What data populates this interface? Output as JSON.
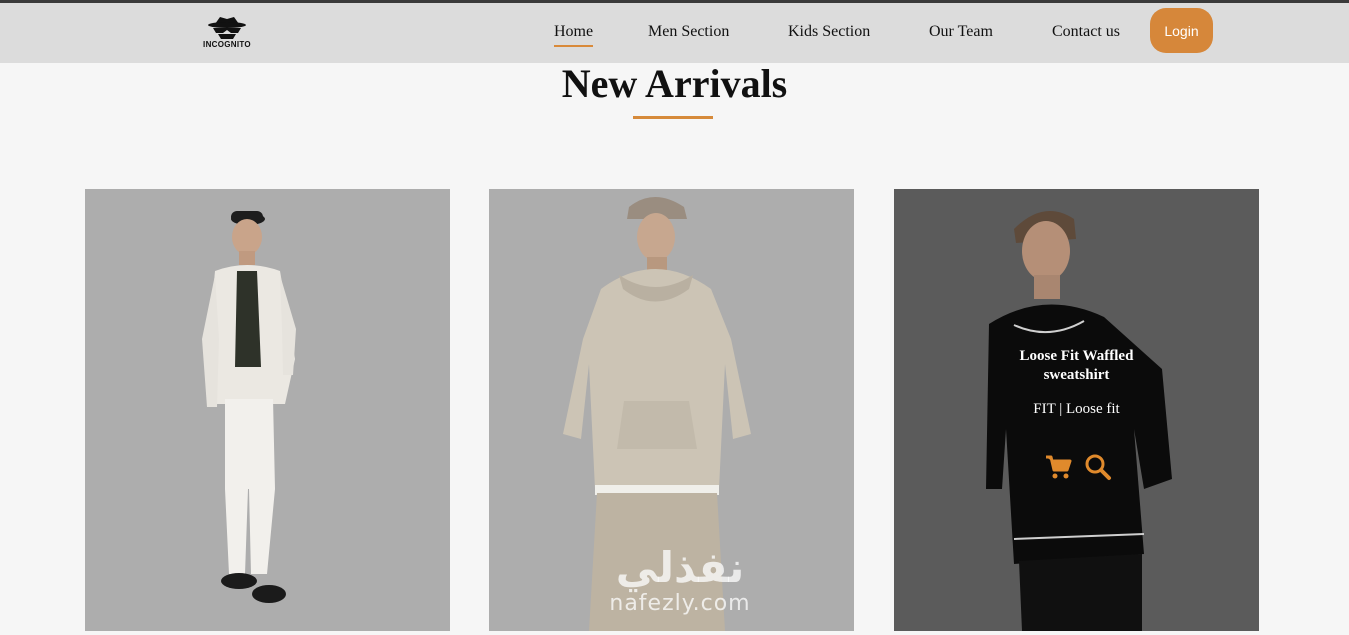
{
  "brand": {
    "logo_text": "INCOGNITO",
    "logo_icon": "incognito-spy-icon"
  },
  "nav": {
    "items": [
      {
        "label": "Home",
        "active": true
      },
      {
        "label": "Men Section"
      },
      {
        "label": "Kids Section"
      },
      {
        "label": "Our Team"
      },
      {
        "label": "Contact us"
      }
    ],
    "login_label": "Login"
  },
  "main": {
    "title": "New Arrivals",
    "products": [
      {
        "image": "model-white-outfit"
      },
      {
        "image": "model-beige-hoodie"
      },
      {
        "image": "model-black-sweatshirt",
        "hover_title": "Loose Fit Waffled sweatshirt",
        "hover_subtitle": "FIT | Loose fit",
        "icons": [
          "cart-icon",
          "search-icon"
        ]
      }
    ]
  },
  "watermark": {
    "arabic": "نفذلي",
    "latin": "nafezly.com"
  },
  "colors": {
    "accent": "#d6873a",
    "header_bg": "#dcdcdc",
    "page_bg": "#f6f6f6"
  }
}
